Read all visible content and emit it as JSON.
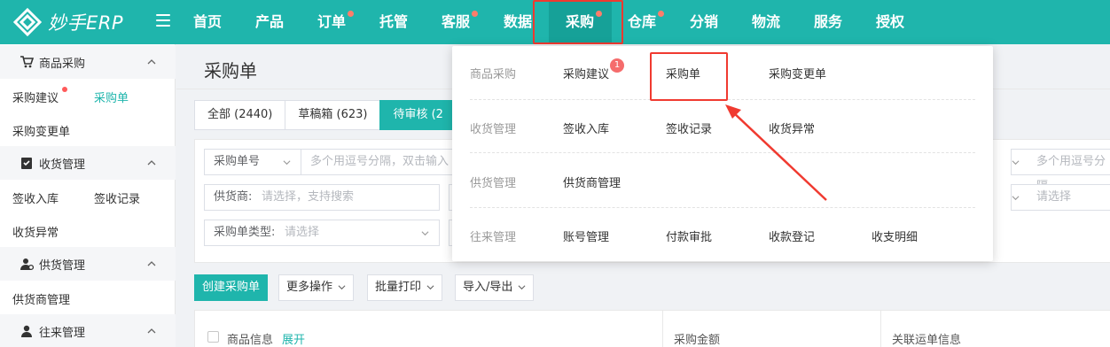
{
  "app": {
    "logo_text": "妙手ERP"
  },
  "colors": {
    "brand": "#1fb5ac",
    "highlight": "#f03a30",
    "badge": "#f56c6c"
  },
  "top_nav": [
    {
      "label": "首页",
      "dot": false
    },
    {
      "label": "产品",
      "dot": false
    },
    {
      "label": "订单",
      "dot": true
    },
    {
      "label": "托管",
      "dot": false
    },
    {
      "label": "客服",
      "dot": true
    },
    {
      "label": "数据",
      "dot": false
    },
    {
      "label": "采购",
      "dot": true,
      "active": true
    },
    {
      "label": "仓库",
      "dot": true
    },
    {
      "label": "分销",
      "dot": false
    },
    {
      "label": "物流",
      "dot": false
    },
    {
      "label": "服务",
      "dot": false
    },
    {
      "label": "授权",
      "dot": false
    }
  ],
  "sidebar": {
    "sections": [
      {
        "title": "商品采购",
        "icon": "cart-icon",
        "items": [
          "采购建议",
          "采购单",
          "采购变更单"
        ]
      },
      {
        "title": "收货管理",
        "icon": "clipboard-check-icon",
        "items": [
          "签收入库",
          "签收记录",
          "收货异常"
        ]
      },
      {
        "title": "供货管理",
        "icon": "supplier-icon",
        "items": [
          "供货商管理"
        ]
      },
      {
        "title": "往来管理",
        "icon": "person-icon",
        "items": []
      }
    ],
    "active_item": "采购单"
  },
  "page": {
    "title": "采购单",
    "tabs": [
      "全部 (2440)",
      "草稿箱 (623)",
      "待审核 (2"
    ],
    "filters": {
      "order_no_label": "采购单号",
      "order_no_placeholder": "多个用逗号分隔，双击输入",
      "supplier_label": "供货商:",
      "supplier_placeholder": "请选择，支持搜索",
      "type_label": "采购单类型:",
      "type_placeholder": "请选择",
      "right_placeholder_1": "多个用逗号分隔",
      "right_placeholder_2": "请选择"
    },
    "actions": {
      "create": "创建采购单",
      "more": "更多操作",
      "batch_print": "批量打印",
      "import_export": "导入/导出"
    },
    "table_headers": {
      "product_info": "商品信息",
      "expand": "展开",
      "amount": "采购金额",
      "shipping": "关联运单信息"
    }
  },
  "dropdown": {
    "rows": [
      {
        "category": "商品采购",
        "items": [
          "采购建议",
          "采购单",
          "采购变更单"
        ]
      },
      {
        "category": "收货管理",
        "items": [
          "签收入库",
          "签收记录",
          "收货异常"
        ]
      },
      {
        "category": "供货管理",
        "items": [
          "供货商管理"
        ]
      },
      {
        "category": "往来管理",
        "items": [
          "账号管理",
          "付款审批",
          "收款登记",
          "收支明细"
        ]
      }
    ],
    "badge": "1"
  }
}
